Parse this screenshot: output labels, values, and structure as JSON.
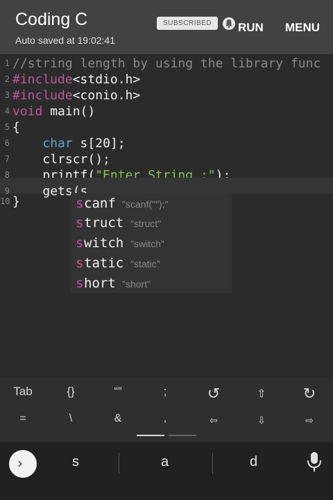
{
  "app": {
    "title": "Coding C",
    "autosave": "Auto saved at 19:02:41",
    "subscribed_label": "SUBSCRIBED",
    "run_label": "RUN",
    "menu_label": "MENU"
  },
  "editor": {
    "line_numbers": [
      "1",
      "2",
      "3",
      "4",
      "5",
      "6",
      "7",
      "8",
      "9",
      "10"
    ],
    "lines": [
      {
        "comment": "//string length by using the library func"
      },
      {
        "directive": "#include",
        "rest": "<stdio.h>"
      },
      {
        "directive": "#include",
        "rest": "<conio.h>"
      },
      {
        "keyword": "void",
        "rest": " main()"
      },
      {
        "rest": "{"
      },
      {
        "indent": "    ",
        "type": "char",
        "rest": " s[20];"
      },
      {
        "indent": "    ",
        "rest": "clrscr();"
      },
      {
        "indent": "    ",
        "func": "printf(",
        "string": "\"Enter String :\"",
        "tail": ");"
      },
      {
        "indent": "    ",
        "func": "gets(",
        "cursor_word": "s"
      },
      {
        "rest": "}"
      }
    ]
  },
  "autocomplete": [
    {
      "prefix": "s",
      "rest": "canf",
      "hint": "\"scanf(\"\");\""
    },
    {
      "prefix": "s",
      "rest": "truct",
      "hint": "\"struct\""
    },
    {
      "prefix": "s",
      "rest": "witch",
      "hint": "\"switch\""
    },
    {
      "prefix": "s",
      "rest": "tatic",
      "hint": "\"static\""
    },
    {
      "prefix": "s",
      "rest": "hort",
      "hint": "\"short\""
    }
  ],
  "symbol_keys": {
    "row1": [
      "Tab",
      "{}",
      "“”",
      ";",
      "↺",
      "⇧",
      "↻"
    ],
    "row2": [
      "=",
      "\\",
      "&",
      ",",
      "⇦",
      "⇩",
      "⇨"
    ]
  },
  "keyboard": {
    "suggestions": [
      "s",
      "a",
      "d"
    ],
    "go_icon": "chevron-right-icon",
    "mic_icon": "mic-icon"
  },
  "colors": {
    "appbar": "#424242",
    "editor_bg": "#2b2b2b",
    "keyword": "#c0569a",
    "type": "#5aa9d6",
    "string": "#8cc152",
    "comment": "#8a8a8a"
  }
}
